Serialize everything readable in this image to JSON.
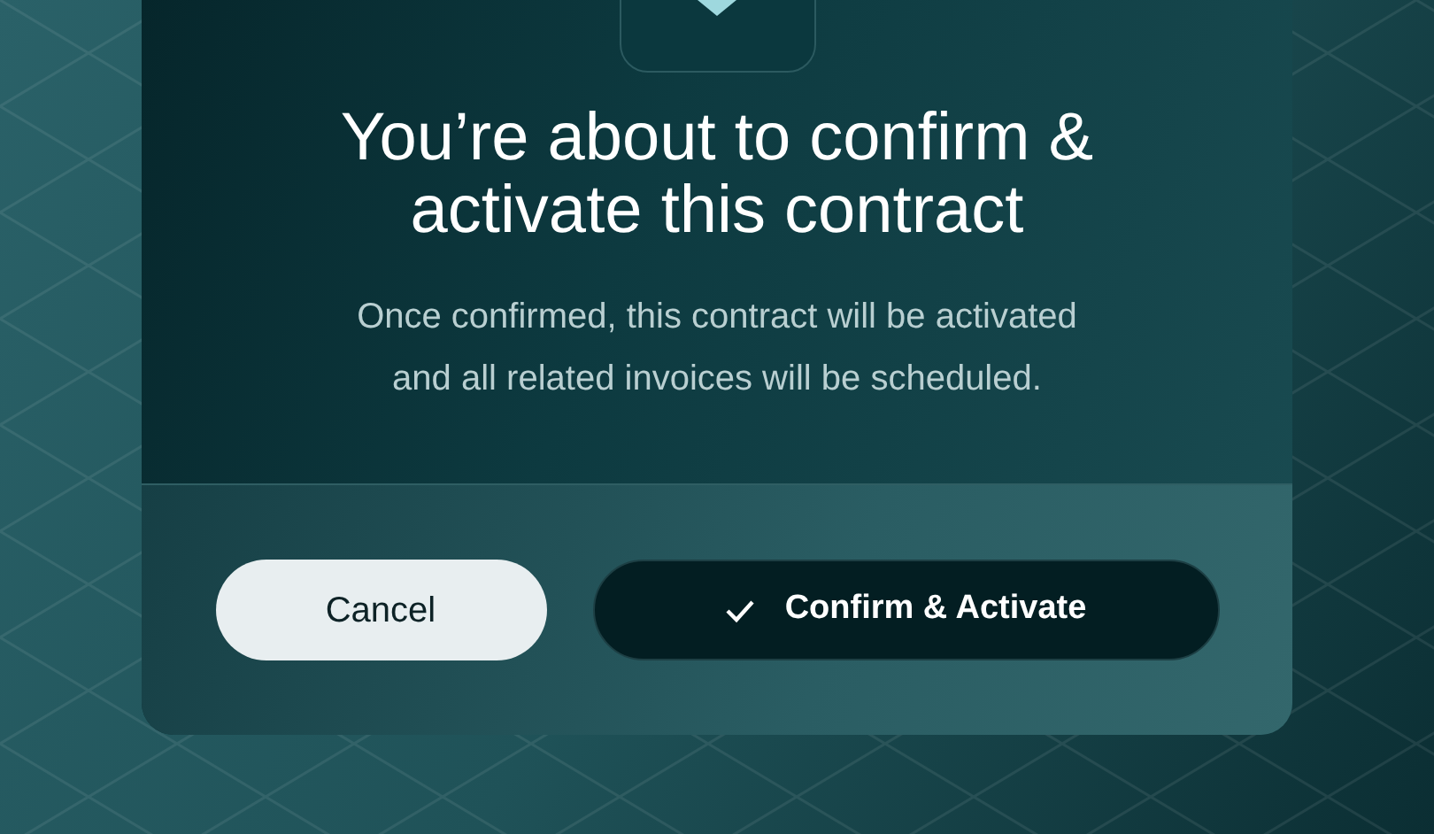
{
  "dialog": {
    "title": "You’re about to confirm & activate this contract",
    "message_lines": [
      "Once confirmed, this contract will be activated",
      "and all related invoices will be scheduled."
    ],
    "buttons": [
      {
        "kind": "secondary",
        "label": "Cancel"
      },
      {
        "kind": "primary",
        "label": "Confirm & Activate"
      }
    ]
  }
}
